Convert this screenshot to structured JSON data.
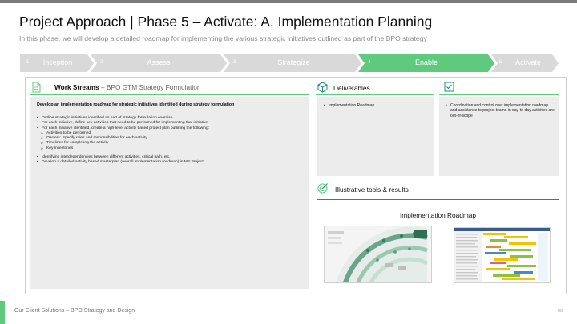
{
  "page": {
    "title": "Project Approach | Phase 5 – Activate: A. Implementation Planning",
    "subtitle": "In this phase, we will develop a detailed roadmap for implementing the various strategic initiatives outlined as part of the BPO strategy"
  },
  "phases": [
    {
      "num": "1",
      "label": "Inception",
      "active": false
    },
    {
      "num": "2",
      "label": "Assess",
      "active": false
    },
    {
      "num": "3",
      "label": "Strategize",
      "active": false
    },
    {
      "num": "4",
      "label": "Enable",
      "active": true
    },
    {
      "num": "5",
      "label": "Activate",
      "active": false
    }
  ],
  "colors": {
    "accent": "#5fc97e",
    "phase_inactive": "#d9d9d9",
    "panel_bg": "#ececec",
    "teal": "#1f8a7f"
  },
  "workstreams": {
    "title": "Work Streams",
    "subtitle": "– BPO GTM Strategy Formulation",
    "icon": "document-icon",
    "heading": "Develop an implementation roadmap for strategic initiatives identified during strategy formulation",
    "items": [
      "Outline strategic initiatives identified as part of strategy formulation exercise",
      "For each initiative, define key activities that need to be performed for implementing that initiative",
      "For each initiative identified, create a high-level activity based project plan outlining the following:"
    ],
    "subitems": [
      "Activities to be performed",
      "Owners: Specify roles and responsibilities for each activity",
      "Timelines for completing the activity",
      "Key milestones"
    ],
    "items2": [
      "Identifying interdependencies between different activities, critical path, etc.",
      "Develop a detailed activity based masterplan (overall implementation roadmap) in MS Project"
    ]
  },
  "deliverables": {
    "title": "Deliverables",
    "icon": "cube-icon",
    "items": [
      "Implementation Roadmap"
    ]
  },
  "scope": {
    "icon": "checkbox-icon",
    "items": [
      "Coordination and control over implementation roadmap and assistance to project teams in day-to-day activities are out-of-scope"
    ]
  },
  "tools": {
    "title": "Illustrative tools & results",
    "icon": "target-icon",
    "roadmap_title": "Implementation Roadmap"
  },
  "footer": {
    "text": "Our Client Solutions – BPO Strategy and Design",
    "page_number": "88"
  }
}
